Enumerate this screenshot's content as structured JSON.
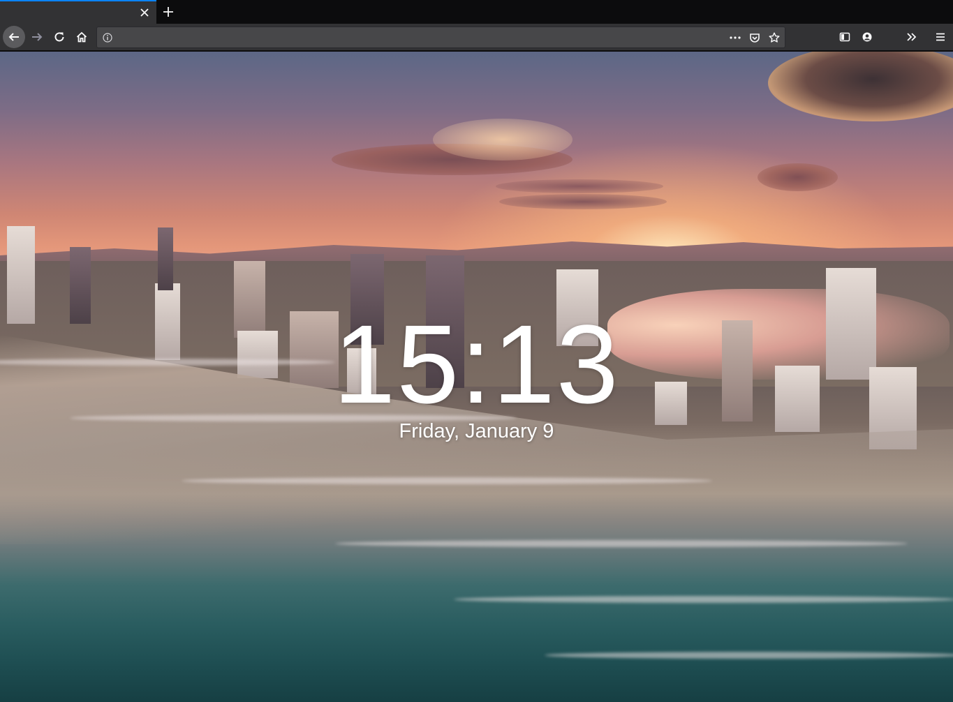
{
  "browser": {
    "tab": {
      "title": ""
    },
    "address_bar": {
      "value": "",
      "placeholder": ""
    }
  },
  "new_tab_page": {
    "time": "15:13",
    "date": "Friday, January 9"
  },
  "colors": {
    "tab_accent": "#0a84ff",
    "toolbar": "#323234",
    "tab_strip": "#0c0c0d"
  },
  "icons": [
    "close-icon",
    "plus-icon",
    "back-arrow-icon",
    "forward-arrow-icon",
    "reload-icon",
    "home-icon",
    "info-icon",
    "more-dots-icon",
    "pocket-icon",
    "star-icon",
    "sidebar-icon",
    "account-icon",
    "overflow-chevron-icon",
    "hamburger-menu-icon"
  ]
}
